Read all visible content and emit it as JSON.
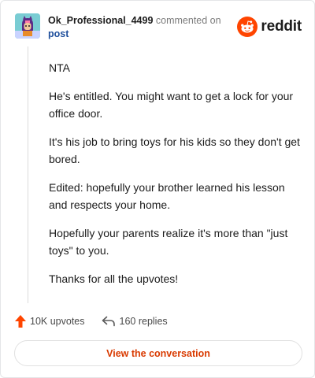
{
  "header": {
    "username": "Ok_Professional_4499",
    "action_text": "commented on",
    "post_link": "post",
    "brand": "reddit"
  },
  "comment": {
    "paragraphs": [
      "NTA",
      "He's entitled. You might want to get a lock for your office door.",
      "It's his job to bring toys for his kids so they don't get bored.",
      "Edited: hopefully your brother learned his lesson and respects your home.",
      "Hopefully your parents realize it's more than \"just toys\" to you.",
      "Thanks for all the upvotes!"
    ]
  },
  "actions": {
    "upvotes": "10K upvotes",
    "replies": "160 replies"
  },
  "footer": {
    "view_button": "View the conversation"
  },
  "colors": {
    "reddit_orange": "#ff4500",
    "upvote_arrow": "#ff4500",
    "link_blue": "#1f4f9c",
    "button_text": "#d93a00"
  },
  "icons": {
    "avatar": "avatar",
    "brand": "reddit-snoo-icon",
    "upvote": "upvote-arrow-icon",
    "reply": "reply-arrow-icon"
  }
}
